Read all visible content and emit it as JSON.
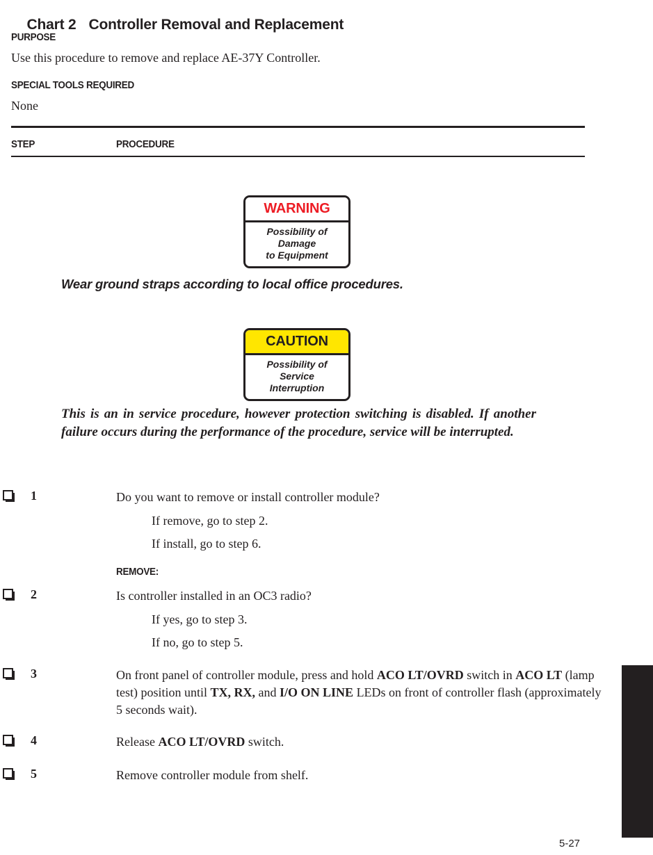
{
  "document": {
    "chart_label": "Chart 2",
    "chart_title": "Controller Removal and Replacement",
    "page_number": "5-27"
  },
  "sections": {
    "purpose_heading": "PURPOSE",
    "purpose_body": "Use this procedure to remove and replace AE-37Y Controller.",
    "tools_heading": "SPECIAL TOOLS REQUIRED",
    "tools_body": "None"
  },
  "table_headers": {
    "step": "STEP",
    "procedure": "PROCEDURE"
  },
  "alerts": [
    {
      "id": "warning",
      "heading": "WARNING",
      "body_lines": [
        "Possibility of",
        "Damage",
        "to Equipment"
      ],
      "heading_color": "#ed1c24",
      "heading_background": "#ffffff",
      "caption": "Wear ground straps according to local office procedures."
    },
    {
      "id": "caution",
      "heading": "CAUTION",
      "body_lines": [
        "Possibility of",
        "Service",
        "Interruption"
      ],
      "heading_color": "#231f20",
      "heading_background": "#ffe600",
      "caption": "This is an in service procedure, however protection switching is disabled.  If another failure occurs during the performance of the procedure, service will be interrupted."
    }
  ],
  "remove_label": "REMOVE:",
  "steps": [
    {
      "number": "1",
      "text_html": "Do you want to remove or install controller module?",
      "substeps": [
        "If remove, go to step 2.",
        "If install, go to step 6."
      ]
    },
    {
      "number": "2",
      "text_html": "Is controller installed in an OC3 radio?",
      "substeps": [
        "If yes, go to step 3.",
        "If no, go to step 5."
      ]
    },
    {
      "number": "3",
      "text_html": "On front panel of controller module, press and hold <b>ACO LT/OVRD</b> switch in <b>ACO LT</b> (lamp test) position until <b>TX, RX,</b> and <b>I/O ON LINE</b> LEDs on front of controller flash (approximately 5 seconds wait).",
      "substeps": []
    },
    {
      "number": "4",
      "text_html": "Release <b>ACO LT/OVRD</b> switch.",
      "substeps": []
    },
    {
      "number": "5",
      "text_html": "Remove controller module from shelf.",
      "substeps": []
    }
  ],
  "colors": {
    "ink": "#231f20",
    "warning_red": "#ed1c24",
    "caution_yellow": "#ffe600",
    "paper": "#ffffff"
  }
}
